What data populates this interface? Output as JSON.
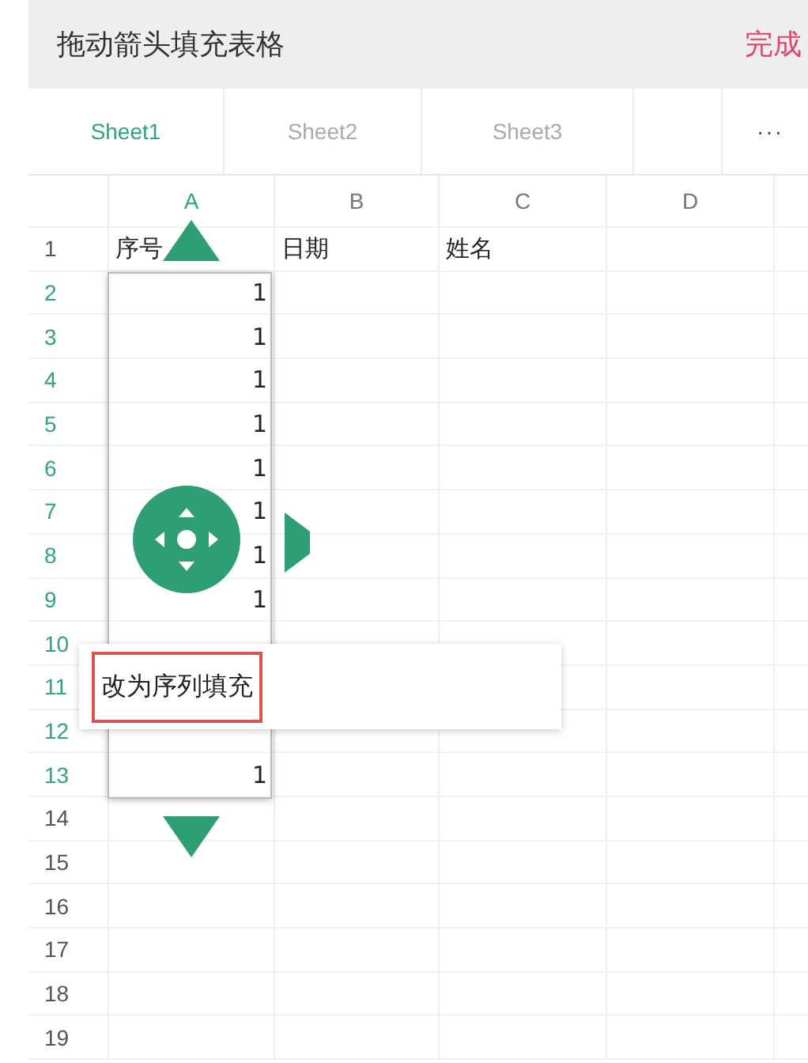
{
  "header": {
    "title": "拖动箭头填充表格",
    "done": "完成"
  },
  "tabs": [
    {
      "label": "Sheet1",
      "selected": true
    },
    {
      "label": "Sheet2",
      "selected": false
    },
    {
      "label": "Sheet3",
      "selected": false
    }
  ],
  "more_button": "···",
  "columns": [
    {
      "label": "A",
      "selected": true
    },
    {
      "label": "B",
      "selected": false
    },
    {
      "label": "C",
      "selected": false
    },
    {
      "label": "D",
      "selected": false
    }
  ],
  "rows": [
    {
      "label": "1",
      "selected": false,
      "cells": [
        "序号",
        "日期",
        "姓名"
      ]
    },
    {
      "label": "2",
      "selected": true,
      "cells": [
        "1"
      ]
    },
    {
      "label": "3",
      "selected": true,
      "cells": [
        "1"
      ]
    },
    {
      "label": "4",
      "selected": true,
      "cells": [
        "1"
      ]
    },
    {
      "label": "5",
      "selected": true,
      "cells": [
        "1"
      ]
    },
    {
      "label": "6",
      "selected": true,
      "cells": [
        "1"
      ]
    },
    {
      "label": "7",
      "selected": true,
      "cells": [
        "1"
      ]
    },
    {
      "label": "8",
      "selected": true,
      "cells": [
        "1"
      ]
    },
    {
      "label": "9",
      "selected": true,
      "cells": [
        "1"
      ]
    },
    {
      "label": "10",
      "selected": true
    },
    {
      "label": "11",
      "selected": true
    },
    {
      "label": "12",
      "selected": true
    },
    {
      "label": "13",
      "selected": true,
      "cells": [
        "1"
      ]
    },
    {
      "label": "14",
      "selected": false
    },
    {
      "label": "15",
      "selected": false
    },
    {
      "label": "16",
      "selected": false
    },
    {
      "label": "17",
      "selected": false
    },
    {
      "label": "18",
      "selected": false
    },
    {
      "label": "19",
      "selected": false
    }
  ],
  "popup": {
    "label": "改为序列填充"
  }
}
